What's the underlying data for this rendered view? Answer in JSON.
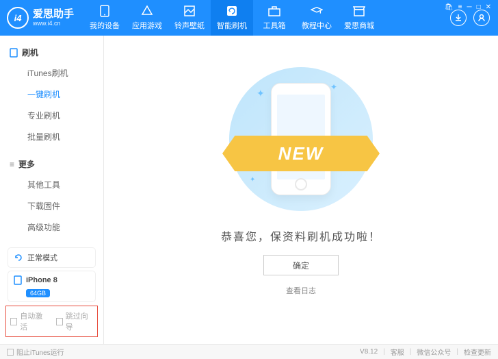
{
  "app": {
    "name": "爱思助手",
    "url": "www.i4.cn",
    "logo_text": "i4",
    "version": "V8.12"
  },
  "tabs": [
    {
      "label": "我的设备"
    },
    {
      "label": "应用游戏"
    },
    {
      "label": "铃声壁纸"
    },
    {
      "label": "智能刷机",
      "active": true
    },
    {
      "label": "工具箱"
    },
    {
      "label": "教程中心"
    },
    {
      "label": "爱思商城"
    }
  ],
  "sidebar": {
    "sections": [
      {
        "title": "刷机",
        "items": [
          {
            "label": "iTunes刷机"
          },
          {
            "label": "一键刷机",
            "active": true
          },
          {
            "label": "专业刷机"
          },
          {
            "label": "批量刷机"
          }
        ]
      },
      {
        "title": "更多",
        "items": [
          {
            "label": "其他工具"
          },
          {
            "label": "下载固件"
          },
          {
            "label": "高级功能"
          }
        ]
      }
    ],
    "mode": {
      "label": "正常模式"
    },
    "device": {
      "model": "iPhone 8",
      "storage": "64GB"
    },
    "options": {
      "auto_activate": "自动激活",
      "skip_wizard": "跳过向导"
    }
  },
  "content": {
    "ribbon": "NEW",
    "success_msg": "恭喜您，保资料刷机成功啦！",
    "ok": "确定",
    "log": "查看日志"
  },
  "footer": {
    "block_itunes": "阻止iTunes运行",
    "links": {
      "service": "客服",
      "wechat": "微信公众号",
      "update": "检查更新"
    }
  }
}
